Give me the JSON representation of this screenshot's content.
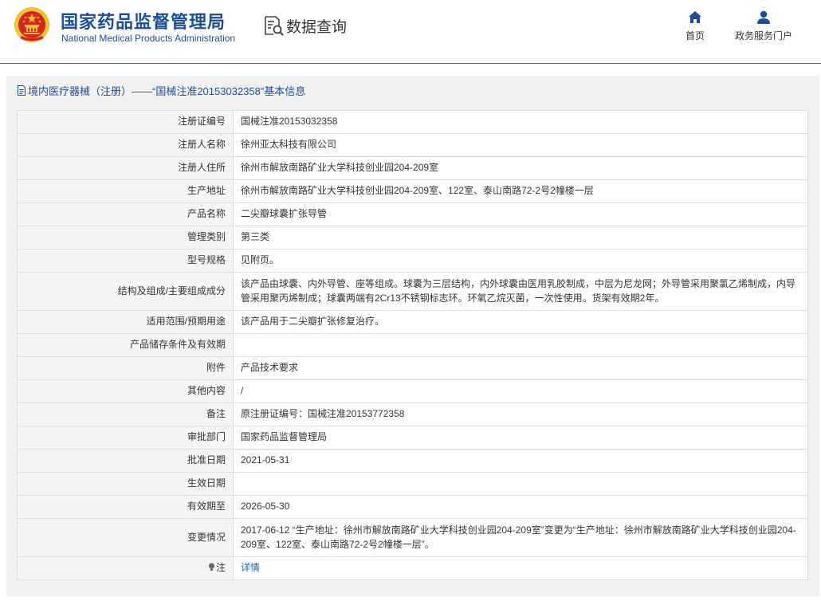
{
  "header": {
    "org_name_cn": "国家药品监督管理局",
    "org_name_en": "National Medical Products Administration",
    "query_label": "数据查询",
    "nav": [
      {
        "label": "首页",
        "icon": "home-icon"
      },
      {
        "label": "政务服务门户",
        "icon": "user-icon"
      }
    ]
  },
  "panel": {
    "title": "境内医疗器械（注册）——“国械注准20153032358”基本信息",
    "rows": [
      {
        "key": "注册证编号",
        "value": "国械注准20153032358"
      },
      {
        "key": "注册人名称",
        "value": "徐州亚太科技有限公司"
      },
      {
        "key": "注册人住所",
        "value": "徐州市解放南路矿业大学科技创业园204-209室"
      },
      {
        "key": "生产地址",
        "value": "徐州市解放南路矿业大学科技创业园204-209室、122室、泰山南路72-2号2幢楼一层"
      },
      {
        "key": "产品名称",
        "value": "二尖瓣球囊扩张导管"
      },
      {
        "key": "管理类别",
        "value": "第三类"
      },
      {
        "key": "型号规格",
        "value": "见附页。"
      },
      {
        "key": "结构及组成/主要组成成分",
        "value": "该产品由球囊、内外导管、座等组成。球囊为三层结构，内外球囊由医用乳胶制成，中层为尼龙网；外导管采用聚氯乙烯制成，内导管采用聚丙烯制成；球囊两端有2Cr13不锈钢标志环。环氧乙烷灭菌，一次性使用。货架有效期2年。"
      },
      {
        "key": "适用范围/预期用途",
        "value": "该产品用于二尖瓣扩张修复治疗。"
      },
      {
        "key": "产品储存条件及有效期",
        "value": ""
      },
      {
        "key": "附件",
        "value": "产品技术要求"
      },
      {
        "key": "其他内容",
        "value": "/"
      },
      {
        "key": "备注",
        "value": "原注册证编号：国械注准20153772358"
      },
      {
        "key": "审批部门",
        "value": "国家药品监督管理局"
      },
      {
        "key": "批准日期",
        "value": "2021-05-31"
      },
      {
        "key": "生效日期",
        "value": ""
      },
      {
        "key": "有效期至",
        "value": "2026-05-30"
      },
      {
        "key": "变更情况",
        "value": "2017-06-12 “生产地址：徐州市解放南路矿业大学科技创业园204-209室”变更为“生产地址：徐州市解放南路矿业大学科技创业园204-209室、122室、泰山南路72-2号2幢楼一层”。"
      }
    ],
    "note_row": {
      "key": "注",
      "link": "详情"
    }
  },
  "colors": {
    "brand_blue": "#1c4e96",
    "link_blue": "#1c66b5",
    "emblem_red": "#d7261e",
    "emblem_gold": "#f2c230"
  }
}
